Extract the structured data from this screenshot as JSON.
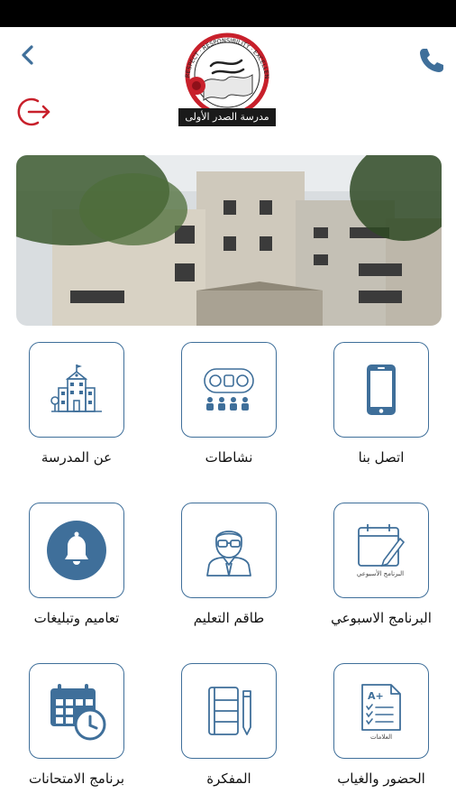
{
  "header": {
    "logo_text": "مدرسة الصدر الأولى",
    "logo_motto": "RESPECT · RESPONSIBILITY · EXCELLENCE"
  },
  "colors": {
    "accent": "#3f6f9a",
    "icon_red": "#c8202b",
    "logo_red": "#c8202b"
  },
  "menu": [
    {
      "label": "عن المدرسة",
      "icon": "school-building-icon"
    },
    {
      "label": "نشاطات",
      "icon": "activities-icon"
    },
    {
      "label": "اتصل بنا",
      "icon": "smartphone-icon"
    },
    {
      "label": "تعاميم وتبليغات",
      "icon": "bell-icon"
    },
    {
      "label": "طاقم التعليم",
      "icon": "teacher-icon"
    },
    {
      "label": "البرنامج الاسبوعي",
      "icon": "weekly-schedule-icon",
      "caption": "البرنامج الأسبوعي"
    },
    {
      "label": "برنامج الامتحانات",
      "icon": "exam-calendar-icon"
    },
    {
      "label": "المفكرة",
      "icon": "notebook-icon"
    },
    {
      "label": "الحضور والغياب",
      "icon": "grades-checklist-icon",
      "caption": "العلامات"
    }
  ]
}
